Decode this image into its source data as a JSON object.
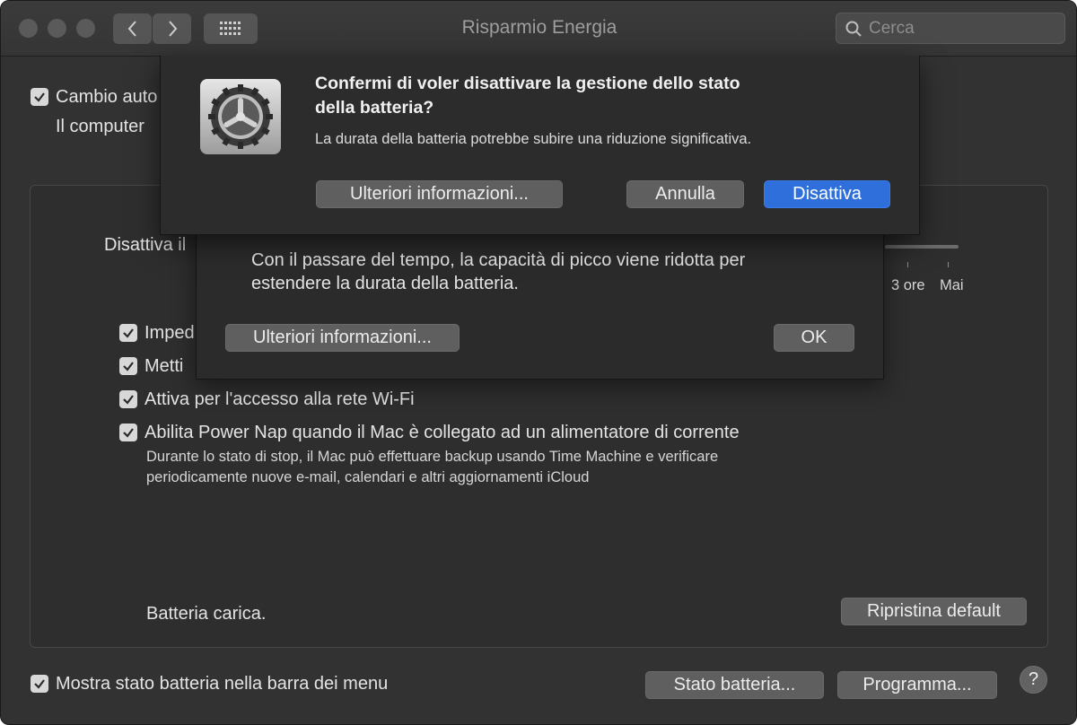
{
  "window": {
    "title": "Risparmio Energia"
  },
  "toolbar": {
    "back_icon": "chevron-left-icon",
    "forward_icon": "chevron-right-icon",
    "grid_icon": "grid-icon",
    "search": {
      "placeholder": "Cerca",
      "value": ""
    }
  },
  "settings": {
    "auto_switch": {
      "label": "Cambio auto",
      "checked": true
    },
    "auto_switch_desc": "Il computer",
    "display_off_label": "Disattiva il",
    "slider_ticks": [
      "3 ore",
      "Mai"
    ],
    "options": [
      {
        "label": "Imped",
        "checked": true
      },
      {
        "label": "Metti",
        "checked": true
      },
      {
        "label": "Attiva per l'accesso alla rete Wi-Fi",
        "checked": true
      },
      {
        "label": "Abilita Power Nap quando il Mac è collegato ad un alimentatore di corrente",
        "checked": true
      }
    ],
    "power_nap_desc_1": "Durante lo stato di stop, il Mac può effettuare backup usando Time Machine e verificare",
    "power_nap_desc_2": "periodicamente nuove e-mail, calendari e altri aggiornamenti iCloud",
    "battery_status": "Batteria carica.",
    "restore_button": "Ripristina default",
    "show_battery": {
      "label": "Mostra stato batteria nella barra dei menu",
      "checked": true
    },
    "battery_state_button": "Stato batteria...",
    "schedule_button": "Programma...",
    "help_label": "?"
  },
  "sheet_battery_health": {
    "desc_1": "Con il passare del tempo, la capacità di picco viene ridotta per",
    "desc_2": "estendere la durata della batteria.",
    "more_info_button": "Ulteriori informazioni...",
    "ok_button": "OK"
  },
  "alert": {
    "icon": "system-preferences-gear-icon",
    "title_1": "Confermi di voler disattivare la gestione dello stato",
    "title_2": "della batteria?",
    "message": "La durata della batteria potrebbe subire una riduzione significativa.",
    "more_info_button": "Ulteriori informazioni...",
    "cancel_button": "Annulla",
    "confirm_button": "Disattiva"
  },
  "colors": {
    "accent": "#2f6fdc",
    "window_bg": "#323232"
  }
}
